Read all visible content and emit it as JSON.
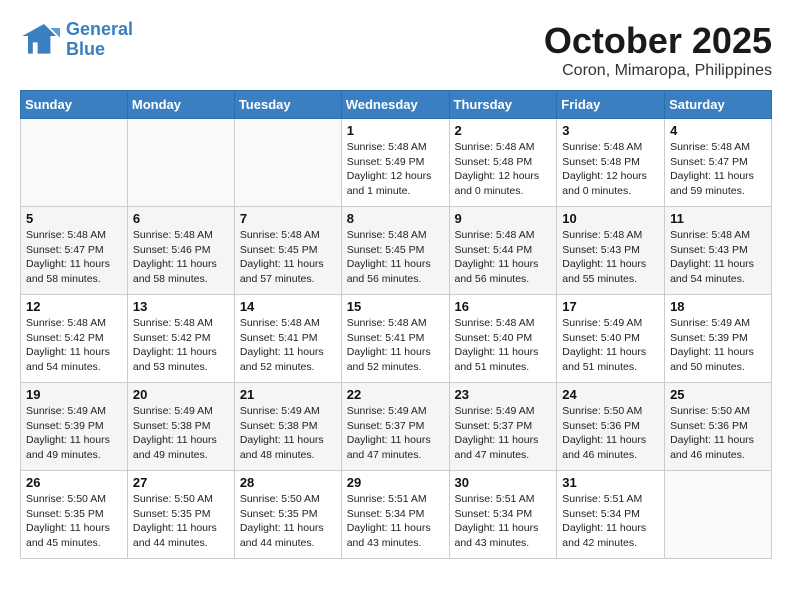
{
  "header": {
    "logo_line1": "General",
    "logo_line2": "Blue",
    "month_title": "October 2025",
    "subtitle": "Coron, Mimaropa, Philippines"
  },
  "weekdays": [
    "Sunday",
    "Monday",
    "Tuesday",
    "Wednesday",
    "Thursday",
    "Friday",
    "Saturday"
  ],
  "weeks": [
    [
      {
        "day": "",
        "info": ""
      },
      {
        "day": "",
        "info": ""
      },
      {
        "day": "",
        "info": ""
      },
      {
        "day": "1",
        "info": "Sunrise: 5:48 AM\nSunset: 5:49 PM\nDaylight: 12 hours\nand 1 minute."
      },
      {
        "day": "2",
        "info": "Sunrise: 5:48 AM\nSunset: 5:48 PM\nDaylight: 12 hours\nand 0 minutes."
      },
      {
        "day": "3",
        "info": "Sunrise: 5:48 AM\nSunset: 5:48 PM\nDaylight: 12 hours\nand 0 minutes."
      },
      {
        "day": "4",
        "info": "Sunrise: 5:48 AM\nSunset: 5:47 PM\nDaylight: 11 hours\nand 59 minutes."
      }
    ],
    [
      {
        "day": "5",
        "info": "Sunrise: 5:48 AM\nSunset: 5:47 PM\nDaylight: 11 hours\nand 58 minutes."
      },
      {
        "day": "6",
        "info": "Sunrise: 5:48 AM\nSunset: 5:46 PM\nDaylight: 11 hours\nand 58 minutes."
      },
      {
        "day": "7",
        "info": "Sunrise: 5:48 AM\nSunset: 5:45 PM\nDaylight: 11 hours\nand 57 minutes."
      },
      {
        "day": "8",
        "info": "Sunrise: 5:48 AM\nSunset: 5:45 PM\nDaylight: 11 hours\nand 56 minutes."
      },
      {
        "day": "9",
        "info": "Sunrise: 5:48 AM\nSunset: 5:44 PM\nDaylight: 11 hours\nand 56 minutes."
      },
      {
        "day": "10",
        "info": "Sunrise: 5:48 AM\nSunset: 5:43 PM\nDaylight: 11 hours\nand 55 minutes."
      },
      {
        "day": "11",
        "info": "Sunrise: 5:48 AM\nSunset: 5:43 PM\nDaylight: 11 hours\nand 54 minutes."
      }
    ],
    [
      {
        "day": "12",
        "info": "Sunrise: 5:48 AM\nSunset: 5:42 PM\nDaylight: 11 hours\nand 54 minutes."
      },
      {
        "day": "13",
        "info": "Sunrise: 5:48 AM\nSunset: 5:42 PM\nDaylight: 11 hours\nand 53 minutes."
      },
      {
        "day": "14",
        "info": "Sunrise: 5:48 AM\nSunset: 5:41 PM\nDaylight: 11 hours\nand 52 minutes."
      },
      {
        "day": "15",
        "info": "Sunrise: 5:48 AM\nSunset: 5:41 PM\nDaylight: 11 hours\nand 52 minutes."
      },
      {
        "day": "16",
        "info": "Sunrise: 5:48 AM\nSunset: 5:40 PM\nDaylight: 11 hours\nand 51 minutes."
      },
      {
        "day": "17",
        "info": "Sunrise: 5:49 AM\nSunset: 5:40 PM\nDaylight: 11 hours\nand 51 minutes."
      },
      {
        "day": "18",
        "info": "Sunrise: 5:49 AM\nSunset: 5:39 PM\nDaylight: 11 hours\nand 50 minutes."
      }
    ],
    [
      {
        "day": "19",
        "info": "Sunrise: 5:49 AM\nSunset: 5:39 PM\nDaylight: 11 hours\nand 49 minutes."
      },
      {
        "day": "20",
        "info": "Sunrise: 5:49 AM\nSunset: 5:38 PM\nDaylight: 11 hours\nand 49 minutes."
      },
      {
        "day": "21",
        "info": "Sunrise: 5:49 AM\nSunset: 5:38 PM\nDaylight: 11 hours\nand 48 minutes."
      },
      {
        "day": "22",
        "info": "Sunrise: 5:49 AM\nSunset: 5:37 PM\nDaylight: 11 hours\nand 47 minutes."
      },
      {
        "day": "23",
        "info": "Sunrise: 5:49 AM\nSunset: 5:37 PM\nDaylight: 11 hours\nand 47 minutes."
      },
      {
        "day": "24",
        "info": "Sunrise: 5:50 AM\nSunset: 5:36 PM\nDaylight: 11 hours\nand 46 minutes."
      },
      {
        "day": "25",
        "info": "Sunrise: 5:50 AM\nSunset: 5:36 PM\nDaylight: 11 hours\nand 46 minutes."
      }
    ],
    [
      {
        "day": "26",
        "info": "Sunrise: 5:50 AM\nSunset: 5:35 PM\nDaylight: 11 hours\nand 45 minutes."
      },
      {
        "day": "27",
        "info": "Sunrise: 5:50 AM\nSunset: 5:35 PM\nDaylight: 11 hours\nand 44 minutes."
      },
      {
        "day": "28",
        "info": "Sunrise: 5:50 AM\nSunset: 5:35 PM\nDaylight: 11 hours\nand 44 minutes."
      },
      {
        "day": "29",
        "info": "Sunrise: 5:51 AM\nSunset: 5:34 PM\nDaylight: 11 hours\nand 43 minutes."
      },
      {
        "day": "30",
        "info": "Sunrise: 5:51 AM\nSunset: 5:34 PM\nDaylight: 11 hours\nand 43 minutes."
      },
      {
        "day": "31",
        "info": "Sunrise: 5:51 AM\nSunset: 5:34 PM\nDaylight: 11 hours\nand 42 minutes."
      },
      {
        "day": "",
        "info": ""
      }
    ]
  ]
}
